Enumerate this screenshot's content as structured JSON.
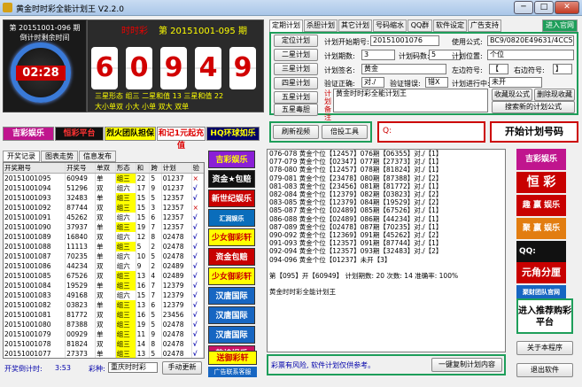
{
  "app": {
    "title": "黄金时时彩全能计划王 V2.2.0",
    "min": "─",
    "max": "□",
    "close": "✕"
  },
  "clock": {
    "line1": "第 20151001-096 期",
    "line2": "倒计时剩余时间",
    "time": "02:28"
  },
  "lottery": {
    "name": "时时彩",
    "period": "第 20151001-095 期",
    "digits": [
      "6",
      "0",
      "9",
      "4",
      "9"
    ],
    "row1": "三星形态  组三 二星和值  13  三星和值  22",
    "row2": "大小单双  小大  小单  双大  双单"
  },
  "ads_top": [
    "吉彩娱乐",
    "恒彩平台",
    "烈火团队担保",
    "和记1元起充值",
    "HQ环球如乐"
  ],
  "tabs": [
    "定期计划",
    "杀胆计划",
    "其它计划",
    "号码缩水",
    "QQ群发",
    "软件设定",
    "广告支持",
    "进入官网"
  ],
  "plan_buttons": [
    "定位计划",
    "二星计划",
    "三星计划",
    "四星计划",
    "五星计划",
    "五星毒胆"
  ],
  "form": {
    "period_label": "计划开始期号:",
    "period_value": "20151001076",
    "method_label": "使用公式:",
    "method_value": "BC9/0820E49631/4CC5",
    "count_label": "计划期数:",
    "count_value": "3",
    "codes_label": "计划码数:",
    "codes_value": "5",
    "pos_label": "计划位置:",
    "pos_value": "个位",
    "sign_label": "计划签名:",
    "sign_value": "黄金",
    "left_label": "左边符号:",
    "left_value": "【",
    "right_label": "右边符号:",
    "right_value": "】",
    "verify_label": "验证正确:",
    "verify_value": "对./",
    "wrong_label": "验证错误:",
    "wrong_value": "错X",
    "progress_label": "计划进行中:",
    "progress_value": "未开",
    "note_label": "计划备注",
    "note_value": "黄金时时彩全能计划王"
  },
  "right_buttons": {
    "collect": "收藏现公式",
    "delete": "删除现收藏",
    "search": "搜索新的计划公式"
  },
  "mid_buttons": {
    "refresh": "刷新视频",
    "tools": "倍投工具",
    "qq": "Q:",
    "start": "开始计划号码"
  },
  "left_tabs": [
    "开奖记录",
    "图表走势",
    "信息发布"
  ],
  "table": {
    "headers": [
      "开奖期号",
      "开奖号",
      "单双",
      "形态",
      "和",
      "跨",
      "计划",
      "验"
    ],
    "rows": [
      [
        "20151001095",
        "60949",
        "单",
        "组三",
        "22",
        "5",
        "01237",
        "×"
      ],
      [
        "20151001094",
        "51296",
        "双",
        "组六",
        "17",
        "9",
        "01237",
        "√"
      ],
      [
        "20151001093",
        "32483",
        "单",
        "组三",
        "15",
        "5",
        "12357",
        "√"
      ],
      [
        "20151001092",
        "87744",
        "双",
        "组三",
        "15",
        "3",
        "12357",
        "×"
      ],
      [
        "20151001091",
        "45262",
        "双",
        "组六",
        "15",
        "6",
        "12357",
        "√"
      ],
      [
        "20151001090",
        "37937",
        "单",
        "组三",
        "19",
        "7",
        "12357",
        "√"
      ],
      [
        "20151001089",
        "16840",
        "双",
        "组六",
        "12",
        "8",
        "02478",
        "√"
      ],
      [
        "20151001088",
        "11113",
        "单",
        "组三",
        "5",
        "2",
        "02478",
        "√"
      ],
      [
        "20151001087",
        "70235",
        "单",
        "组六",
        "10",
        "5",
        "02478",
        "√"
      ],
      [
        "20151001086",
        "44234",
        "双",
        "组六",
        "9",
        "2",
        "02489",
        "√"
      ],
      [
        "20151001085",
        "67526",
        "双",
        "组三",
        "13",
        "4",
        "02489",
        "√"
      ],
      [
        "20151001084",
        "19529",
        "单",
        "组三",
        "16",
        "7",
        "12379",
        "√"
      ],
      [
        "20151001083",
        "49168",
        "双",
        "组六",
        "15",
        "7",
        "12379",
        "√"
      ],
      [
        "20151001082",
        "03823",
        "单",
        "组三",
        "13",
        "6",
        "12379",
        "√"
      ],
      [
        "20151001081",
        "81772",
        "双",
        "组三",
        "16",
        "5",
        "23456",
        "√"
      ],
      [
        "20151001080",
        "87388",
        "双",
        "组三",
        "19",
        "5",
        "02478",
        "√"
      ],
      [
        "20151001079",
        "00929",
        "单",
        "组三",
        "11",
        "9",
        "02478",
        "√"
      ],
      [
        "20151001078",
        "81824",
        "双",
        "组三",
        "14",
        "8",
        "02478",
        "√"
      ],
      [
        "20151001077",
        "27373",
        "单",
        "组三",
        "13",
        "5",
        "02478",
        "√"
      ]
    ]
  },
  "bottom_left": {
    "countdown_label": "开奖倒计时:",
    "countdown": "3:53",
    "type_label": "彩种:",
    "type_value": "重庆时时彩",
    "refresh": "手动更新"
  },
  "adcol": [
    "吉彩娱乐",
    "资金★包赔",
    "新世纪娱乐",
    "汇润娱乐",
    "少女御彩轩",
    "资金包赔",
    "少女御彩轩",
    "汉唐国际",
    "汉唐国际",
    "汉唐国际",
    "乾坤娱乐",
    "送御彩轩",
    "广告联系客服"
  ],
  "results": [
    "076-078 黄金个位【12457】076期【06355】对./【1】",
    "077-079 黄金个位【02347】077期【27373】对./【1】",
    "078-080 黄金个位【12457】078期【81824】对./【1】",
    "079-081 黄金个位【23478】080期【87388】对./【2】",
    "081-083 黄金个位【23456】081期【81772】对./【1】",
    "082-084 黄金个位【12379】082期【03823】对./【2】",
    "083-085 黄金个位【12379】084期【19529】对./【2】",
    "085-087 黄金个位【02489】085期【67526】对./【1】",
    "086-088 黄金个位【02489】086期【44234】对./【1】",
    "087-089 黄金个位【02478】087期【70235】对./【1】",
    "090-092 黄金个位【12369】091期【45262】对./【2】",
    "091-093 黄金个位【12357】091期【87744】对./【1】",
    "092-094 黄金个位【12357】093期【32483】对./【2】",
    "094-096 黄金个位【01237】未开【3】",
    "",
    "第【095】开【60949】 计划期数: 20  次数: 14  准确率: 100%",
    "",
    "黄金时时彩全能计划王"
  ],
  "res_footer": {
    "warning": "彩票有风险, 软件计划仅供参考。",
    "copy": "一键复制计划内容"
  },
  "right_ads": [
    "吉彩娱乐",
    "恒 彩",
    "趣 赢 娱乐",
    "聚 赢 娱乐",
    "QQ:",
    "元角分厘",
    "聚财团队官网"
  ],
  "right_bottom": {
    "enter": "进入推荐购彩平台",
    "about": "关于本程序",
    "exit": "退出软件"
  }
}
